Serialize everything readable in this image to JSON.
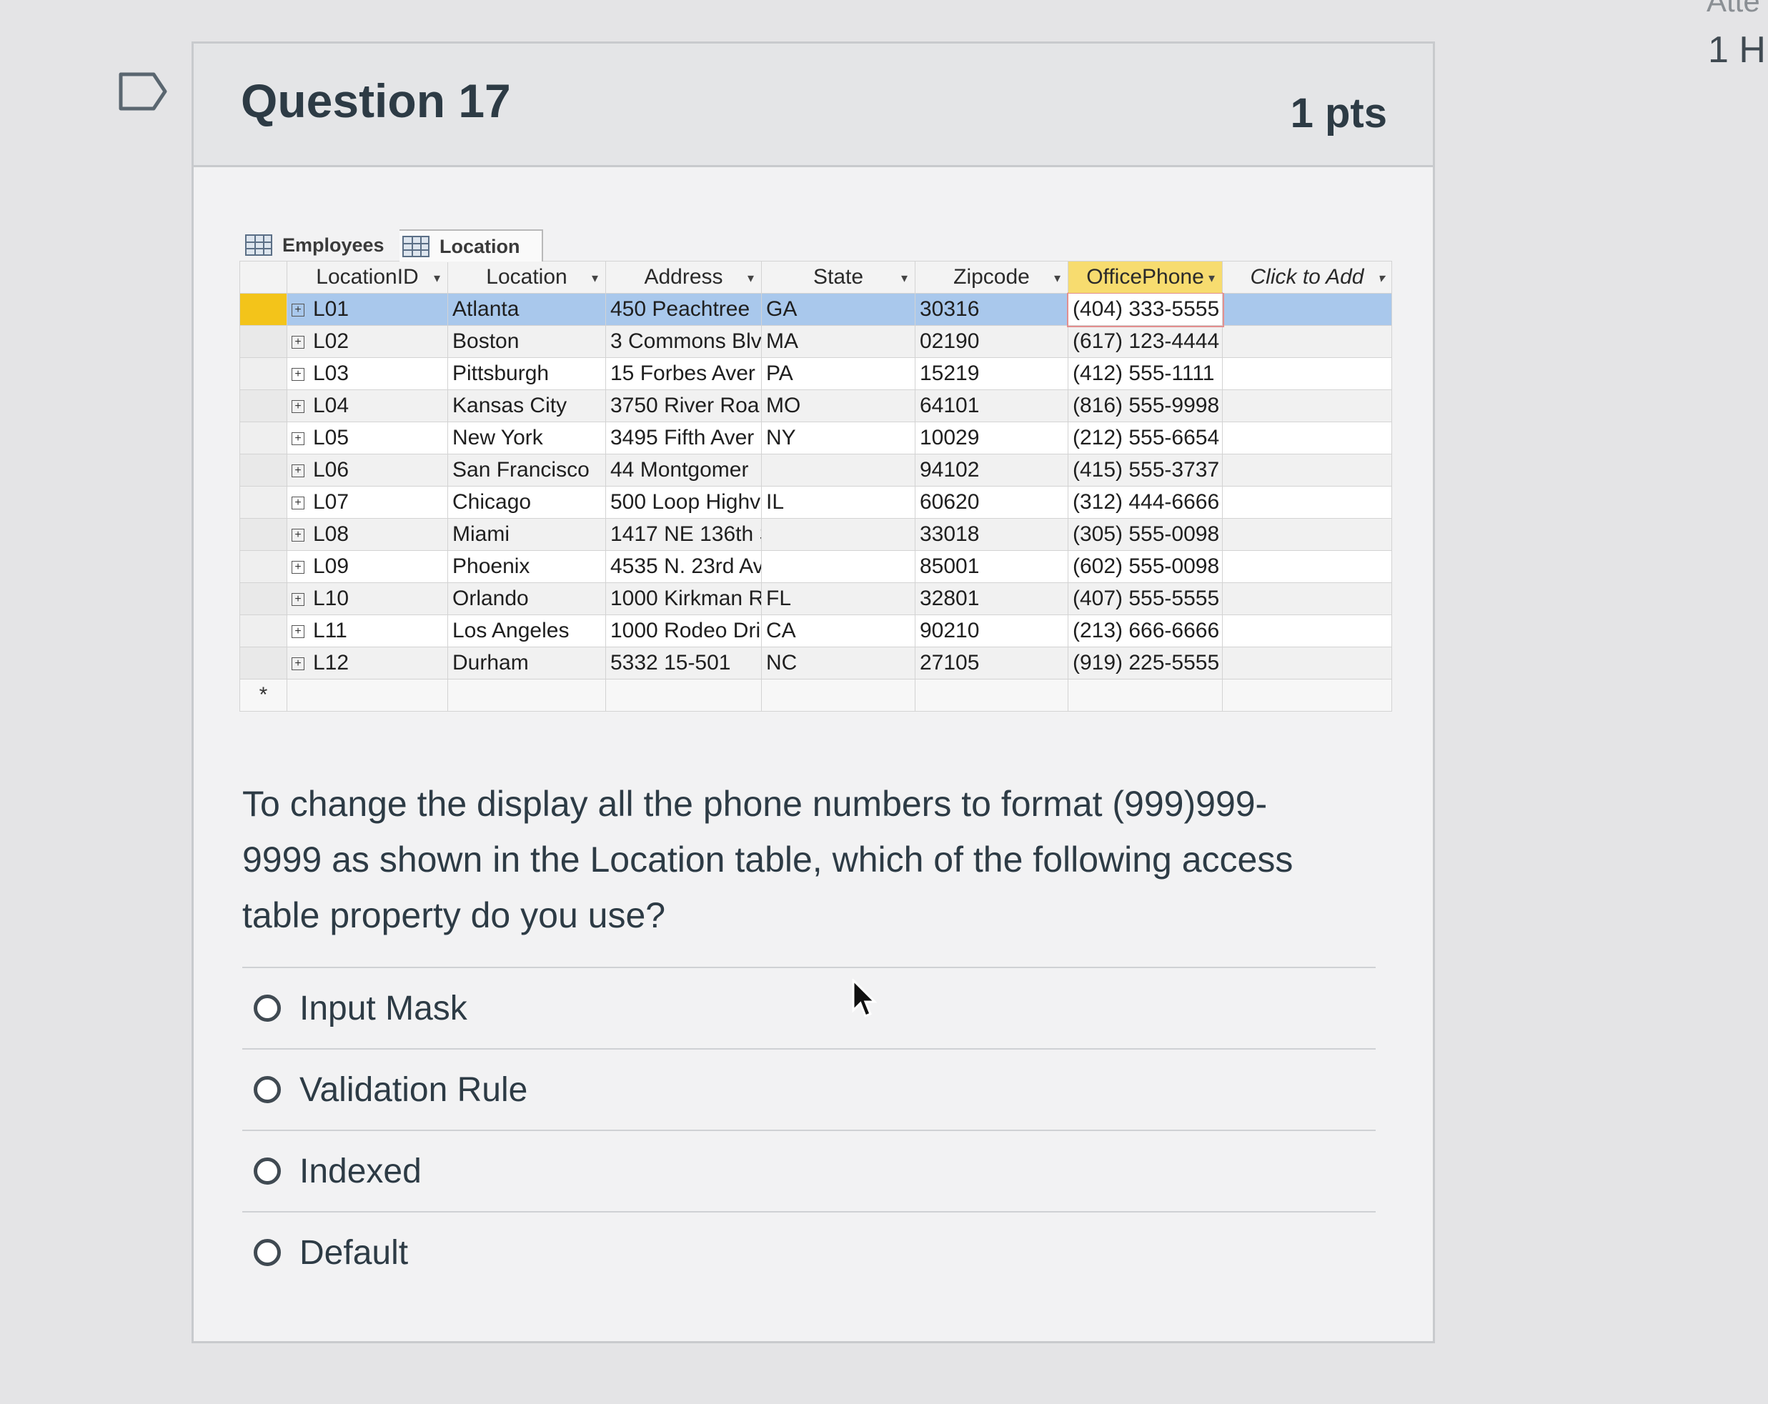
{
  "side": {
    "top_text": "Atte",
    "hours_text": "1 H"
  },
  "question": {
    "title": "Question 17",
    "points": "1 pts"
  },
  "access": {
    "tabs": [
      "Employees",
      "Location"
    ],
    "columns": [
      "LocationID",
      "Location",
      "Address",
      "State",
      "Zipcode",
      "OfficePhone",
      "Click to Add"
    ],
    "rows": [
      {
        "id": "L01",
        "location": "Atlanta",
        "address": "450 Peachtree",
        "state": "GA",
        "zip": "30316",
        "phone": "(404) 333-5555"
      },
      {
        "id": "L02",
        "location": "Boston",
        "address": "3 Commons Blv",
        "state": "MA",
        "zip": "02190",
        "phone": "(617) 123-4444"
      },
      {
        "id": "L03",
        "location": "Pittsburgh",
        "address": "15 Forbes Aver",
        "state": "PA",
        "zip": "15219",
        "phone": "(412) 555-1111"
      },
      {
        "id": "L04",
        "location": "Kansas City",
        "address": "3750 River Roa",
        "state": "MO",
        "zip": "64101",
        "phone": "(816) 555-9998"
      },
      {
        "id": "L05",
        "location": "New York",
        "address": "3495 Fifth Aver",
        "state": "NY",
        "zip": "10029",
        "phone": "(212) 555-6654"
      },
      {
        "id": "L06",
        "location": "San Francisco",
        "address": "44 Montgomer",
        "state": "",
        "zip": "94102",
        "phone": "(415) 555-3737"
      },
      {
        "id": "L07",
        "location": "Chicago",
        "address": "500 Loop Highv",
        "state": "IL",
        "zip": "60620",
        "phone": "(312) 444-6666"
      },
      {
        "id": "L08",
        "location": "Miami",
        "address": "1417 NE 136th S",
        "state": "",
        "zip": "33018",
        "phone": "(305) 555-0098"
      },
      {
        "id": "L09",
        "location": "Phoenix",
        "address": "4535 N. 23rd Av",
        "state": "",
        "zip": "85001",
        "phone": "(602) 555-0098"
      },
      {
        "id": "L10",
        "location": "Orlando",
        "address": "1000 Kirkman R",
        "state": "FL",
        "zip": "32801",
        "phone": "(407) 555-5555"
      },
      {
        "id": "L11",
        "location": "Los Angeles",
        "address": "1000 Rodeo Dri",
        "state": "CA",
        "zip": "90210",
        "phone": "(213) 666-6666"
      },
      {
        "id": "L12",
        "location": "Durham",
        "address": "5332 15-501",
        "state": "NC",
        "zip": "27105",
        "phone": "(919) 225-5555"
      }
    ],
    "new_row_marker": "*"
  },
  "prompt": "To change the display all the phone numbers to format (999)999-9999 as shown in the Location table, which of the following access table property do you use?",
  "answers": [
    "Input Mask",
    "Validation Rule",
    "Indexed",
    "Default"
  ]
}
